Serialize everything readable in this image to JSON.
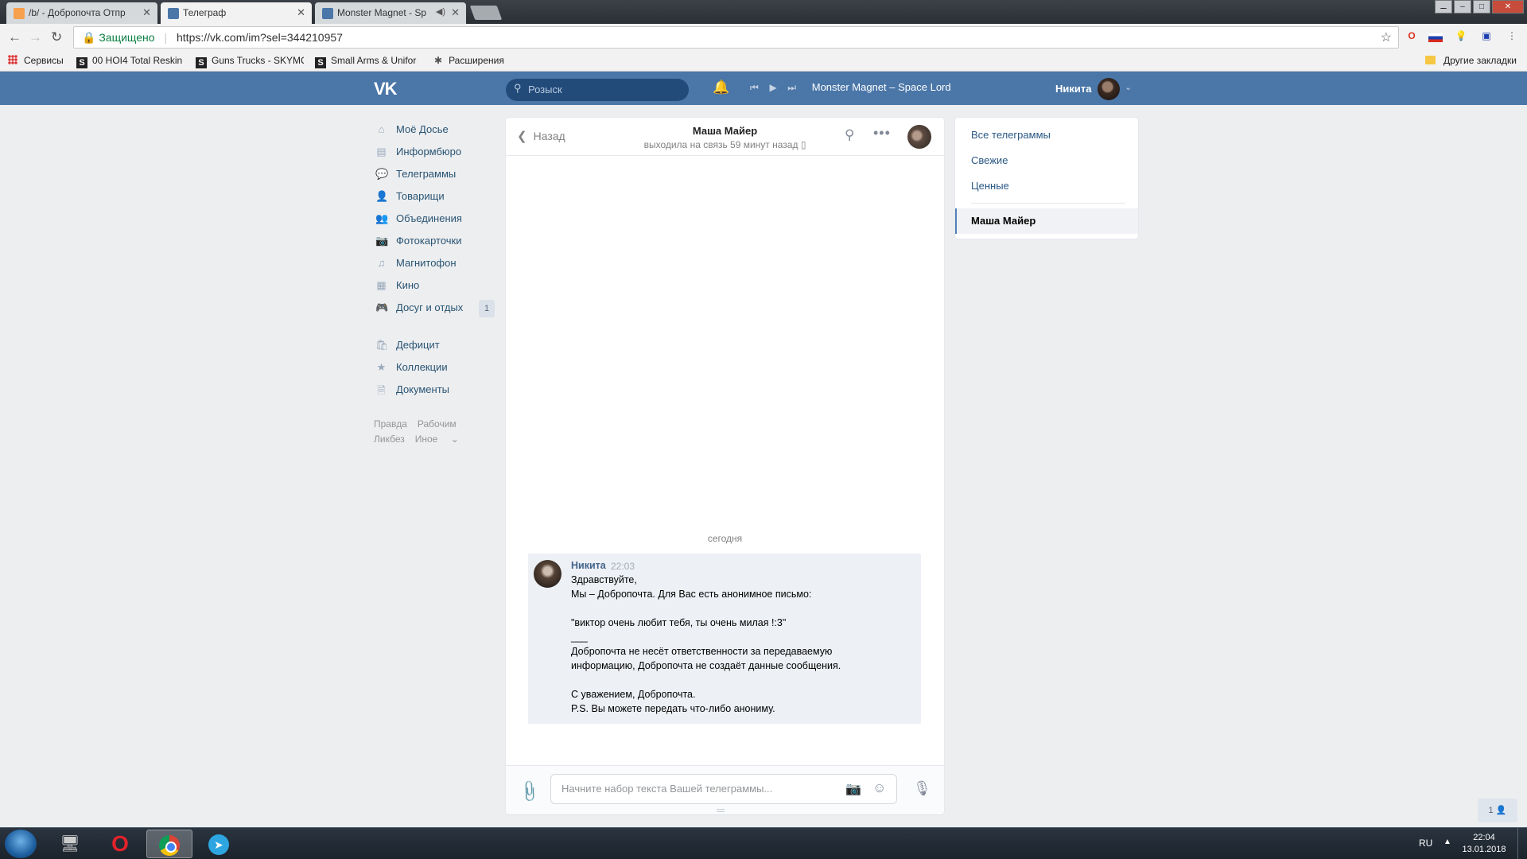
{
  "browser": {
    "tabs": [
      {
        "label": "/b/ - Добропочта Отпр",
        "active": false
      },
      {
        "label": "Телеграф",
        "active": true
      },
      {
        "label": "Monster Magnet - Sp",
        "active": false
      }
    ],
    "address": {
      "secure_label": "Защищено",
      "url": "https://vk.com/im?sel=344210957"
    },
    "bookmarks": [
      {
        "label": "Сервисы"
      },
      {
        "label": "00 HOI4 Total Reskin"
      },
      {
        "label": "Guns Trucks - SKYMC"
      },
      {
        "label": "Small Arms & Unifor"
      },
      {
        "label": "Расширения"
      }
    ],
    "other_bookmarks": "Другие закладки"
  },
  "vk": {
    "search_placeholder": "Розыск",
    "player_track": "Monster Magnet – Space Lord",
    "user_name": "Никита",
    "accent": "#4a76a8"
  },
  "left_menu": {
    "items": [
      {
        "label": "Моё Досье",
        "icon": "home-icon"
      },
      {
        "label": "Информбюро",
        "icon": "news-icon"
      },
      {
        "label": "Телеграммы",
        "icon": "messages-icon"
      },
      {
        "label": "Товарищи",
        "icon": "friend-icon"
      },
      {
        "label": "Объединения",
        "icon": "groups-icon"
      },
      {
        "label": "Фотокарточки",
        "icon": "camera-icon"
      },
      {
        "label": "Магнитофон",
        "icon": "music-icon"
      },
      {
        "label": "Кино",
        "icon": "film-icon"
      },
      {
        "label": "Досуг и отдых",
        "icon": "gamepad-icon",
        "badge": "1"
      }
    ],
    "items2": [
      {
        "label": "Дефицит",
        "icon": "bag-icon"
      },
      {
        "label": "Коллекции",
        "icon": "star-icon"
      },
      {
        "label": "Документы",
        "icon": "document-icon"
      }
    ],
    "footer": {
      "pravda": "Правда",
      "rabochim": "Рабочим",
      "likbez": "Ликбез",
      "inoe": "Иное"
    }
  },
  "chat": {
    "back_label": "Назад",
    "peer_name": "Маша Майер",
    "last_seen": "выходила на связь 59 минут назад",
    "day_separator": "сегодня",
    "message": {
      "author": "Никита",
      "time": "22:03",
      "text": "Здравствуйте,\nМы – Добропочта. Для Вас есть анонимное письмо:\n\n\"виктор очень любит тебя, ты очень милая !:3\"\n___\nДобропочта не несёт ответственности за передаваемую\nинформацию, Добропочта не создаёт данные сообщения.\n\nС уважением, Добропочта.\nP.S. Вы можете передать что-либо анониму."
    },
    "composer_placeholder": "Начните набор текста Вашей телеграммы..."
  },
  "right_panel": {
    "items": [
      "Все телеграммы",
      "Свежие",
      "Ценные"
    ],
    "active_conversation": "Маша Майер"
  },
  "online_widget": "1",
  "taskbar": {
    "language": "RU",
    "time": "22:04",
    "date": "13.01.2018"
  }
}
